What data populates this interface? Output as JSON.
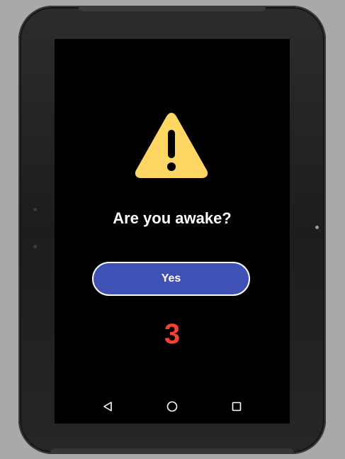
{
  "dialog": {
    "title": "Are you awake?",
    "yes_label": "Yes",
    "countdown": "3"
  },
  "icons": {
    "alert": "warning-icon",
    "nav_back": "back-icon",
    "nav_home": "home-icon",
    "nav_recents": "recents-icon"
  },
  "colors": {
    "screen_background": "#000000",
    "warning": "#FDD663",
    "button": "#3F51B5",
    "button_border": "#FFFFFF",
    "text": "#FFFFFF",
    "countdown": "#F44336",
    "nav_icons": "#FFFFFF"
  }
}
